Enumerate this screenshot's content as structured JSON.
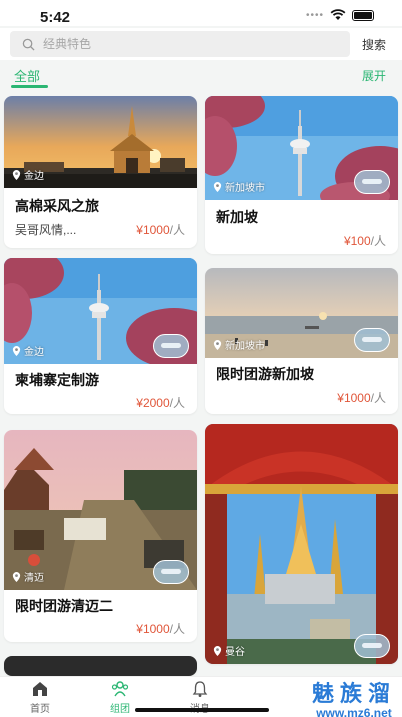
{
  "status": {
    "time": "5:42"
  },
  "search": {
    "placeholder": "经典特色",
    "button": "搜索"
  },
  "tabs": {
    "all": "全部",
    "expand": "展开"
  },
  "cards": [
    {
      "location": "金边",
      "title": "高棉采风之旅",
      "subtitle": "吴哥风情,...",
      "price": "¥1000",
      "unit": "/人"
    },
    {
      "location": "新加坡市",
      "title": "新加坡",
      "price": "¥100",
      "unit": "/人"
    },
    {
      "location": "金边",
      "title": "柬埔寨定制游",
      "price": "¥2000",
      "unit": "/人"
    },
    {
      "location": "新加坡市",
      "title": "限时团游新加坡",
      "price": "¥1000",
      "unit": "/人"
    },
    {
      "location": "清迈",
      "title": "限时团游清迈二",
      "price": "¥1000",
      "unit": "/人"
    },
    {
      "location": "曼谷",
      "title": "",
      "price": "",
      "unit": ""
    }
  ],
  "nav": {
    "home": "首页",
    "group": "组团",
    "messages": "消息"
  },
  "watermark": {
    "title": "魅族溜",
    "url": "www.mz6.net"
  },
  "colors": {
    "accent": "#2bb673",
    "price": "#e0563a",
    "watermark": "#2a7bd6"
  },
  "icons": [
    "search-icon",
    "location-pin-icon",
    "home-icon",
    "group-icon",
    "bell-icon",
    "wifi-icon",
    "battery-icon"
  ]
}
